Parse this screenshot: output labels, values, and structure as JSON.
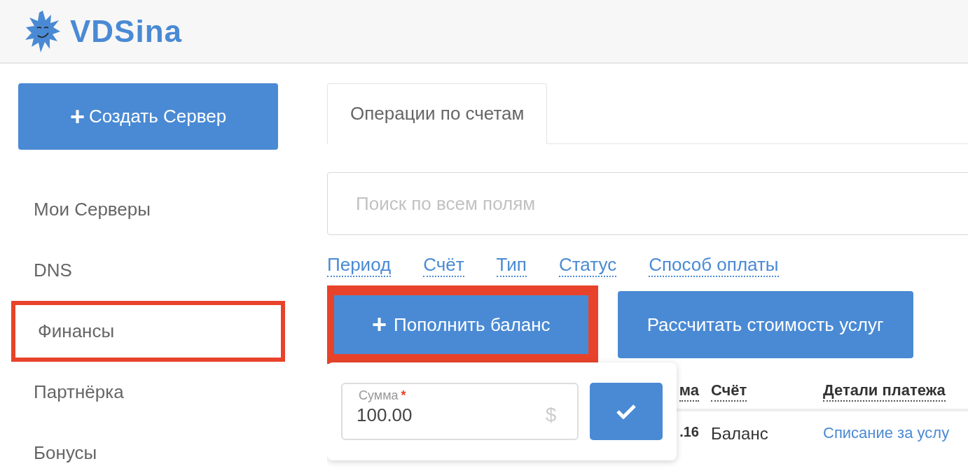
{
  "header": {
    "logo_text": "VDSina"
  },
  "sidebar": {
    "create_button": {
      "icon": "+",
      "label": "Создать Сервер"
    },
    "items": [
      {
        "label": "Мои Серверы",
        "highlighted": false
      },
      {
        "label": "DNS",
        "highlighted": false
      },
      {
        "label": "Финансы",
        "highlighted": true
      },
      {
        "label": "Партнёрка",
        "highlighted": false
      },
      {
        "label": "Бонусы",
        "highlighted": false
      }
    ]
  },
  "tabs": [
    {
      "label": "Операции по счетам",
      "selected": true
    }
  ],
  "search": {
    "placeholder": "Поиск по всем полям"
  },
  "filters": [
    "Период",
    "Счёт",
    "Тип",
    "Статус",
    "Способ оплаты"
  ],
  "actions": [
    {
      "icon": "+",
      "label": "Пополнить баланс",
      "highlighted": true
    },
    {
      "label": "Рассчитать стоимость услуг",
      "highlighted": false
    }
  ],
  "popover": {
    "field": {
      "label": "Сумма",
      "required_mark": "*",
      "value": "100.00",
      "unit": "$"
    }
  },
  "table": {
    "columns": [
      "ма",
      "Счёт",
      "Детали платежа"
    ],
    "rows": [
      [
        ".16",
        "Баланс",
        "Списание за услу"
      ]
    ]
  }
}
